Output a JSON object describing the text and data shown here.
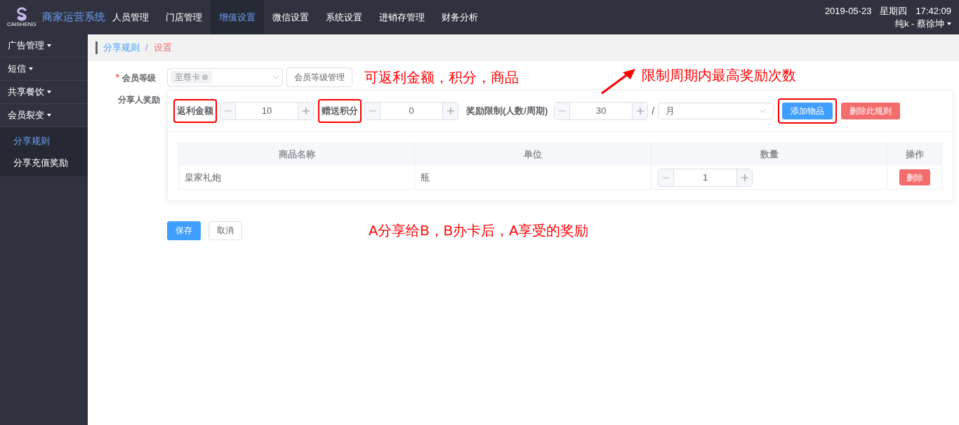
{
  "header": {
    "logo_text": "CAISHENG",
    "app_title": "商家运营系统",
    "date": "2019-05-23",
    "weekday": "星期四",
    "time": "17:42:09",
    "user": "纯k - 蔡徐坤"
  },
  "nav": [
    {
      "label": "人员管理",
      "selected": false
    },
    {
      "label": "门店管理",
      "selected": false
    },
    {
      "label": "增值设置",
      "selected": true
    },
    {
      "label": "微信设置",
      "selected": false
    },
    {
      "label": "系统设置",
      "selected": false
    },
    {
      "label": "进销存管理",
      "selected": false
    },
    {
      "label": "财务分析",
      "selected": false
    }
  ],
  "sidebar": {
    "items": [
      {
        "label": "广告管理"
      },
      {
        "label": "短信"
      },
      {
        "label": "共享餐饮"
      },
      {
        "label": "会员裂变",
        "children": [
          {
            "label": "分享规则",
            "selected": true
          },
          {
            "label": "分享充值奖励",
            "selected": false
          }
        ]
      }
    ]
  },
  "breadcrumb": [
    {
      "label": "分享规则",
      "current": false
    },
    {
      "label": "设置",
      "current": true
    }
  ],
  "breadcrumb_separator": "/",
  "form": {
    "member_level": {
      "label": "会员等级",
      "required_mark": "*",
      "tag": "至尊卡",
      "manage_button": "会员等级管理"
    },
    "reward": {
      "label": "分享人奖励",
      "steppers": [
        {
          "label": "返利金额",
          "value": "10",
          "highlighted": true
        },
        {
          "label": "赠送积分",
          "value": "0",
          "highlighted": true
        },
        {
          "label": "奖励限制(人数/周期)",
          "value": "30",
          "highlighted": false
        }
      ],
      "separator": "/",
      "period": "月",
      "add_button": "添加物品",
      "add_highlighted": true,
      "delete_rule_button": "删除此规则",
      "table": {
        "columns": [
          "商品名称",
          "单位",
          "数量",
          "操作"
        ],
        "rows": [
          {
            "name": "皇家礼炮",
            "unit": "瓶",
            "quantity": "1",
            "action": "删除"
          }
        ]
      }
    },
    "save": "保存",
    "cancel": "取消"
  },
  "annotations": [
    "可返利金额，积分，商品",
    "限制周期内最高奖励次数",
    "A分享给B，B办卡后，A享受的奖励"
  ]
}
